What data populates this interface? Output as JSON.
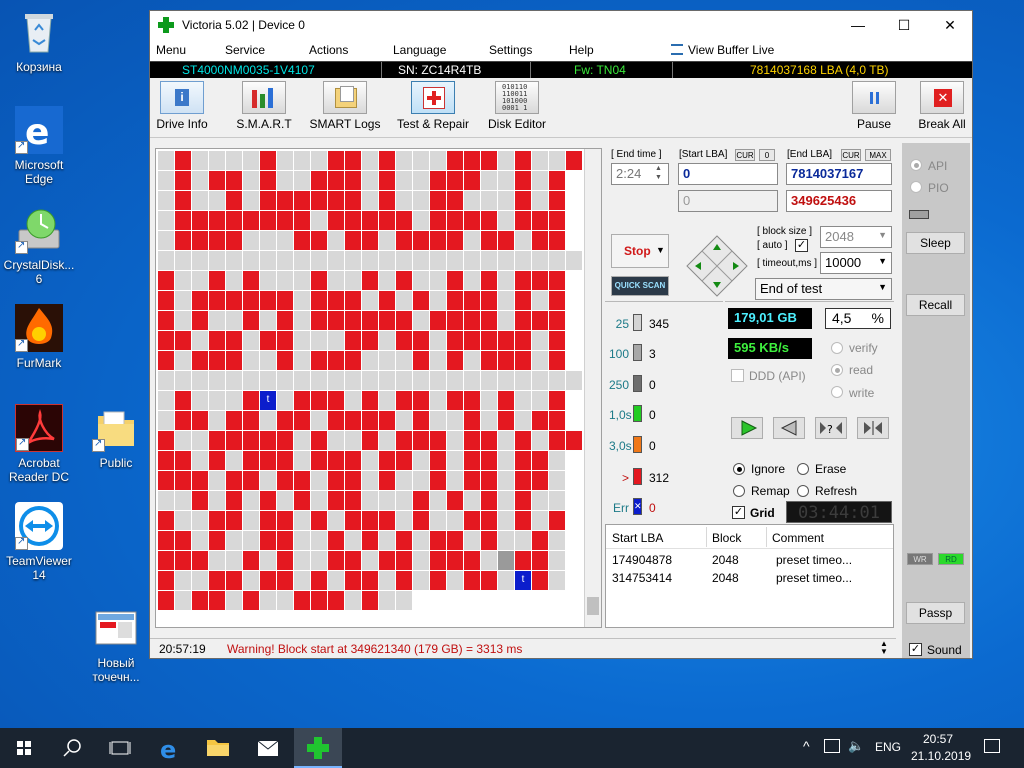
{
  "desktop": {
    "icons": [
      {
        "label": "Корзина"
      },
      {
        "label": "Microsoft Edge"
      },
      {
        "label": "CrystalDisk... 6"
      },
      {
        "label": "FurMark"
      },
      {
        "label": "Acrobat Reader DC"
      },
      {
        "label": "Public"
      },
      {
        "label": "TeamViewer 14"
      },
      {
        "label": "Новый точечн..."
      }
    ],
    "icon_names": [
      "recycle-bin-icon",
      "edge-icon",
      "crystaldisk-icon",
      "furmark-icon",
      "acrobat-icon",
      "folder-icon",
      "teamviewer-icon",
      "bitmap-file-icon"
    ]
  },
  "window": {
    "title": "Victoria 5.02 | Device 0",
    "minimize": "—",
    "maximize": "☐",
    "close": "✕",
    "menu": [
      "Menu",
      "Service",
      "Actions",
      "Language",
      "Settings",
      "Help"
    ],
    "view_buffer": "View Buffer Live",
    "info": {
      "model": "ST4000NM0035-1V4107",
      "serial": "SN: ZC14R4TB",
      "firmware": "Fw: TN04",
      "capacity": "7814037168 LBA (4,0 TB)"
    },
    "toolbar": {
      "drive_info": "Drive Info",
      "smart": "S.M.A.R.T",
      "smart_logs": "SMART Logs",
      "test_repair": "Test & Repair",
      "disk_editor": "Disk Editor",
      "pause": "Pause",
      "break_all": "Break All"
    }
  },
  "test": {
    "end_time_label": "[ End time ]",
    "end_time": "2:24",
    "start_lba_label": "[Start LBA]",
    "cur_label": "CUR",
    "cur_value": "0",
    "start_lba": "0",
    "start_lba_current": "0",
    "end_lba_label": "[End LBA]",
    "end_lba_cur": "CUR",
    "end_lba_max": "MAX",
    "end_lba": "7814037167",
    "current_lba": "349625436",
    "stop": "Stop",
    "quick_scan": "QUICK SCAN",
    "block_size_label": "[ block size ]",
    "auto_label": "[ auto ]",
    "block_size": "2048",
    "timeout_label": "[ timeout,ms ]",
    "timeout": "10000",
    "end_action": "End of test"
  },
  "legend": [
    {
      "label": "25",
      "count": "345",
      "color": "#d4d4d4"
    },
    {
      "label": "100",
      "count": "3",
      "color": "#a8a8a8"
    },
    {
      "label": "250",
      "count": "0",
      "color": "#6e6e6e"
    },
    {
      "label": "1,0s",
      "count": "0",
      "color": "#22cc22"
    },
    {
      "label": "3,0s",
      "count": "0",
      "color": "#f07818"
    },
    {
      "label": ">",
      "count": "312",
      "color": "#e41820"
    },
    {
      "label": "Err",
      "count": "0",
      "color": "#0b1dcc"
    }
  ],
  "stats": {
    "position_gb": "179,01 GB",
    "percent": "4,5",
    "percent_sign": "%",
    "speed": "595 KB/s",
    "ddd_api": "DDD (API)",
    "verify": "verify",
    "read": "read",
    "write": "write"
  },
  "actions": {
    "ignore": "Ignore",
    "erase": "Erase",
    "remap": "Remap",
    "refresh": "Refresh",
    "grid": "Grid",
    "timer": "03:44:01"
  },
  "log_table": {
    "headers": [
      "Start LBA",
      "Block",
      "Comment"
    ],
    "rows": [
      [
        "174904878",
        "2048",
        "preset timeo..."
      ],
      [
        "314753414",
        "2048",
        "preset timeo..."
      ]
    ]
  },
  "right": {
    "api": "API",
    "pio": "PIO",
    "sleep": "Sleep",
    "recall": "Recall",
    "wr": "WR",
    "rd": "RD",
    "passp": "Passp",
    "sound": "Sound"
  },
  "status": {
    "time": "20:57:19",
    "message": "Warning! Block start at 349621340 (179 GB)  = 3313 ms"
  },
  "grid_markers": {
    "t1": "t",
    "t2": "t"
  },
  "taskbar": {
    "lang": "ENG",
    "time": "20:57",
    "date": "21.10.2019"
  }
}
